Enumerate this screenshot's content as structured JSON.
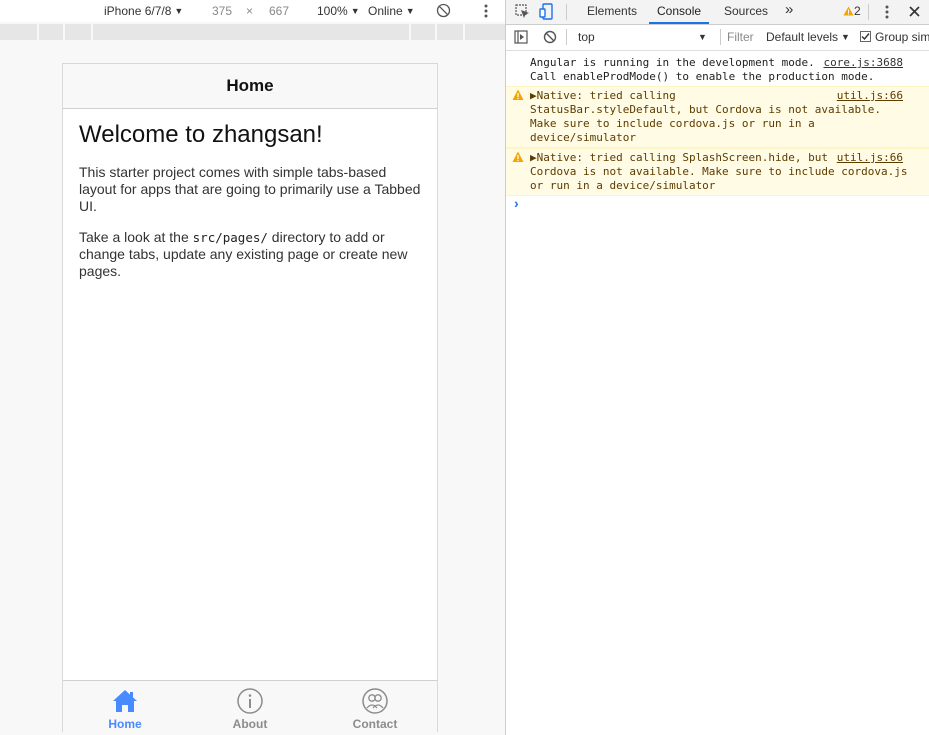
{
  "device_toolbar": {
    "device": "iPhone 6/7/8",
    "width": "375",
    "times": "×",
    "height": "667",
    "zoom": "100%",
    "network": "Online"
  },
  "app": {
    "header_title": "Home",
    "welcome": "Welcome to zhangsan!",
    "para1": "This starter project comes with simple tabs-based layout for apps that are going to primarily use a Tabbed UI.",
    "para2_before": "Take a look at the ",
    "para2_code": "src/pages/",
    "para2_after": " directory to add or change tabs, update any existing page or create new pages.",
    "tabs": [
      {
        "label": "Home",
        "icon": "home-icon",
        "active": true
      },
      {
        "label": "About",
        "icon": "info-icon",
        "active": false
      },
      {
        "label": "Contact",
        "icon": "contacts-icon",
        "active": false
      }
    ],
    "accent": "#488aff"
  },
  "devtools": {
    "tabs": [
      "Elements",
      "Console",
      "Sources"
    ],
    "more": "»",
    "warning_count": "2",
    "context": "top",
    "filter_placeholder": "Filter",
    "levels": "Default levels",
    "group_similar": "Group sim"
  },
  "console": {
    "messages": [
      {
        "level": "log",
        "text": "Angular is running in the development mode.\nCall enableProdMode() to enable the production mode.",
        "source": "core.js:3688"
      },
      {
        "level": "warning",
        "text": "▶Native: tried calling\nStatusBar.styleDefault, but Cordova is not available.\nMake sure to include cordova.js or run in a\ndevice/simulator",
        "source": "util.js:66"
      },
      {
        "level": "warning",
        "text": "▶Native: tried calling SplashScreen.hide, but\nCordova is not available. Make sure to include cordova.js\nor run in a device/simulator",
        "source": "util.js:66"
      }
    ],
    "prompt": "›"
  }
}
